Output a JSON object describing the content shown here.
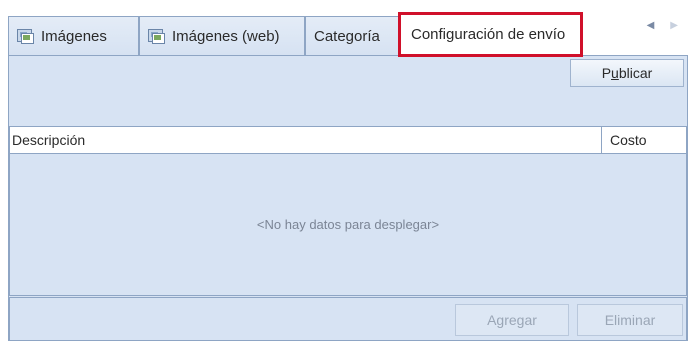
{
  "tabs": [
    {
      "label": "Imágenes",
      "icon": "image-icon"
    },
    {
      "label": "Imágenes (web)",
      "icon": "image-web-icon"
    },
    {
      "label": "Categoría"
    },
    {
      "label": "Configuración de envío",
      "active": true
    }
  ],
  "toolbar": {
    "publish_label_prefix": "P",
    "publish_label_accel": "u",
    "publish_label_rest": "blicar"
  },
  "grid": {
    "columns": [
      "Descripción",
      "Costo"
    ],
    "empty_message": "<No hay datos para desplegar>"
  },
  "actions": {
    "add_label": "Agregar",
    "delete_label": "Eliminar"
  },
  "colors": {
    "highlight": "#d0102a",
    "panel": "#d7e3f3"
  }
}
